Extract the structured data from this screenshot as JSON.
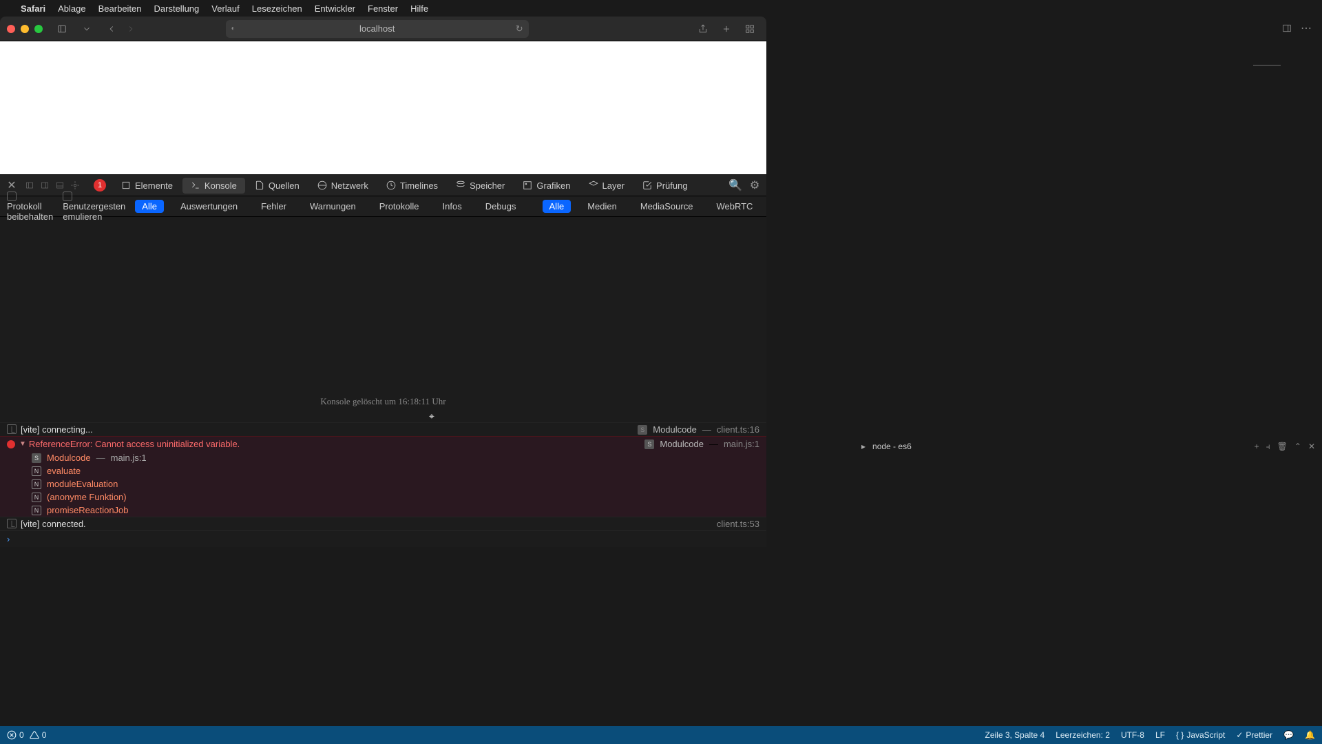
{
  "menubar": {
    "app": "Safari",
    "items": [
      "Ablage",
      "Bearbeiten",
      "Darstellung",
      "Verlauf",
      "Lesezeichen",
      "Entwickler",
      "Fenster",
      "Hilfe"
    ]
  },
  "toolbar": {
    "address": "localhost"
  },
  "devtools": {
    "error_count": "1",
    "tabs": [
      "Elemente",
      "Konsole",
      "Quellen",
      "Netzwerk",
      "Timelines",
      "Speicher",
      "Grafiken",
      "Layer",
      "Prüfung"
    ],
    "active_tab": "Konsole",
    "filter": {
      "preserve": "Protokoll beibehalten",
      "emulate": "Benutzergesten emulieren",
      "levels": [
        "Alle",
        "Auswertungen",
        "Fehler",
        "Warnungen",
        "Protokolle",
        "Infos",
        "Debugs"
      ],
      "sources": [
        "Alle",
        "Medien",
        "MediaSource",
        "WebRTC"
      ]
    },
    "cleared": "Konsole gelöscht um 16:18:11 Uhr",
    "rows": {
      "connecting": "[vite] connecting...",
      "connecting_mod": "Modulcode",
      "connecting_loc": "client.ts:16",
      "error_msg": "ReferenceError: Cannot access uninitialized variable.",
      "error_mod": "Modulcode",
      "error_loc": "main.js:1",
      "stack": [
        {
          "badge": "S",
          "name": "Modulcode",
          "file": "main.js:1"
        },
        {
          "badge": "N",
          "name": "evaluate",
          "file": ""
        },
        {
          "badge": "N",
          "name": "moduleEvaluation",
          "file": ""
        },
        {
          "badge": "N",
          "name": "(anonyme Funktion)",
          "file": ""
        },
        {
          "badge": "N",
          "name": "promiseReactionJob",
          "file": ""
        }
      ],
      "connected": "[vite] connected.",
      "connected_loc": "client.ts:53"
    }
  },
  "terminal": {
    "label": "node - es6"
  },
  "statusbar": {
    "errors": "0",
    "warnings": "0",
    "position": "Zeile 3, Spalte 4",
    "spaces": "Leerzeichen: 2",
    "encoding": "UTF-8",
    "eol": "LF",
    "lang": "JavaScript",
    "prettier": "Prettier"
  }
}
